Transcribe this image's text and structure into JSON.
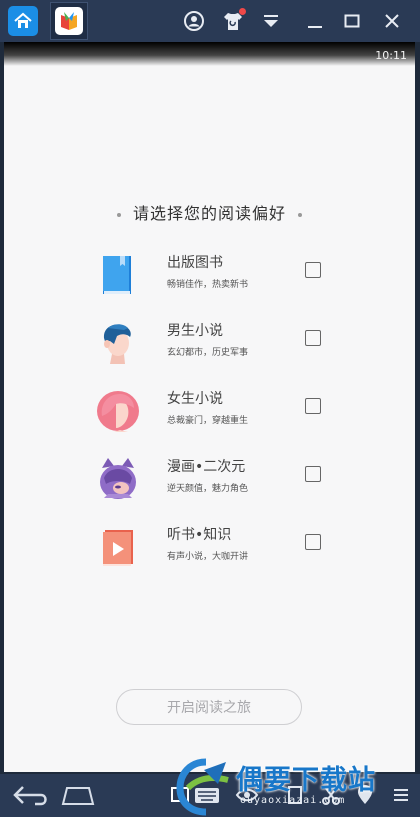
{
  "statusbar": {
    "time": "10:11"
  },
  "page": {
    "heading": "请选择您的阅读偏好",
    "preferences": [
      {
        "title": "出版图书",
        "subtitle": "畅销佳作，热卖新书",
        "icon": "book-icon",
        "checked": false
      },
      {
        "title": "男生小说",
        "subtitle": "玄幻都市，历史军事",
        "icon": "boy-avatar-icon",
        "checked": false
      },
      {
        "title": "女生小说",
        "subtitle": "总裁豪门，穿越重生",
        "icon": "girl-avatar-icon",
        "checked": false
      },
      {
        "title": "漫画•二次元",
        "subtitle": "逆天颜值，魅力角色",
        "icon": "anime-avatar-icon",
        "checked": false
      },
      {
        "title": "听书•知识",
        "subtitle": "有声小说，大咖开讲",
        "icon": "play-book-icon",
        "checked": false
      }
    ],
    "start_button": "开启阅读之旅"
  },
  "watermark": {
    "text": "偶要下载站",
    "subtext": "ouyaoxiazai.com"
  },
  "colors": {
    "accent": "#1b8ee6",
    "titlebar": "#2a3a55",
    "background": "#f7f7f8"
  }
}
